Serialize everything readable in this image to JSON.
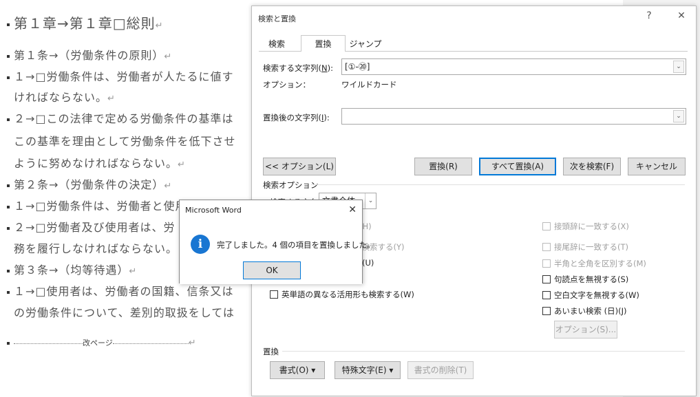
{
  "document": {
    "heading": "第１章→第１章□総則",
    "lines": [
      "第１条→（労働条件の原則）",
      "１→□労働条件は、労働者が人たるに値す",
      "ければならない。",
      "２→□この法律で定める労働条件の基準は",
      "この基準を理由として労働条件を低下させ",
      "ように努めなければならない。",
      "第２条→（労働条件の決定）",
      "１→□労働条件は、労働者と使用者が、対",
      "２→□労働者及び使用者は、労",
      "務を履行しなければならない。",
      "第３条→（均等待遇）",
      "１→□使用者は、労働者の国籍、信条又は",
      "の労働条件について、差別的取扱をしては"
    ],
    "page_break": "改ページ"
  },
  "find_replace": {
    "title": "検索と置換",
    "help": "?",
    "close": "✕",
    "tabs": [
      "検索",
      "置換",
      "ジャンプ"
    ],
    "find_label": "検索する文字列(",
    "find_label_key": "N",
    "find_label_end": "):",
    "find_value": "[①-⑳]",
    "options_label": "オプション：",
    "options_value": "ワイルドカード",
    "replace_label": "置換後の文字列(",
    "replace_label_key": "I",
    "replace_label_end": "):",
    "replace_value": "",
    "buttons": {
      "options": "<< オプション(L)",
      "replace": "置換(R)",
      "replace_all": "すべて置換(A)",
      "find_next": "次を検索(F)",
      "cancel": "キャンセル"
    },
    "search_options_header": "検索オプション",
    "search_direction_label": "検索する方向",
    "search_direction_value": "文書全体",
    "left_checks": [
      "する(H)",
      "を検索する(Y)",
      "(U)",
      "英単語の異なる活用形も検索する(W)"
    ],
    "right_checks": [
      {
        "label": "接頭辞に一致する(X)",
        "disabled": true
      },
      {
        "label": "接尾辞に一致する(T)",
        "disabled": true
      },
      {
        "label": "半角と全角を区別する(M)",
        "disabled": true
      },
      {
        "label": "句読点を無視する(S)",
        "disabled": false
      },
      {
        "label": "空白文字を無視する(W)",
        "disabled": false
      },
      {
        "label": "あいまい検索 (日)(J)",
        "disabled": false
      }
    ],
    "fuzzy_options_button": "オプション(S)...",
    "replace_section": "置換",
    "format_button": "書式(O) ▾",
    "special_button": "特殊文字(E) ▾",
    "clear_format_button": "書式の削除(T)"
  },
  "message_box": {
    "title": "Microsoft Word",
    "close": "✕",
    "icon": "i",
    "message": "完了しました。4 個の項目を置換しました。",
    "ok": "OK"
  }
}
